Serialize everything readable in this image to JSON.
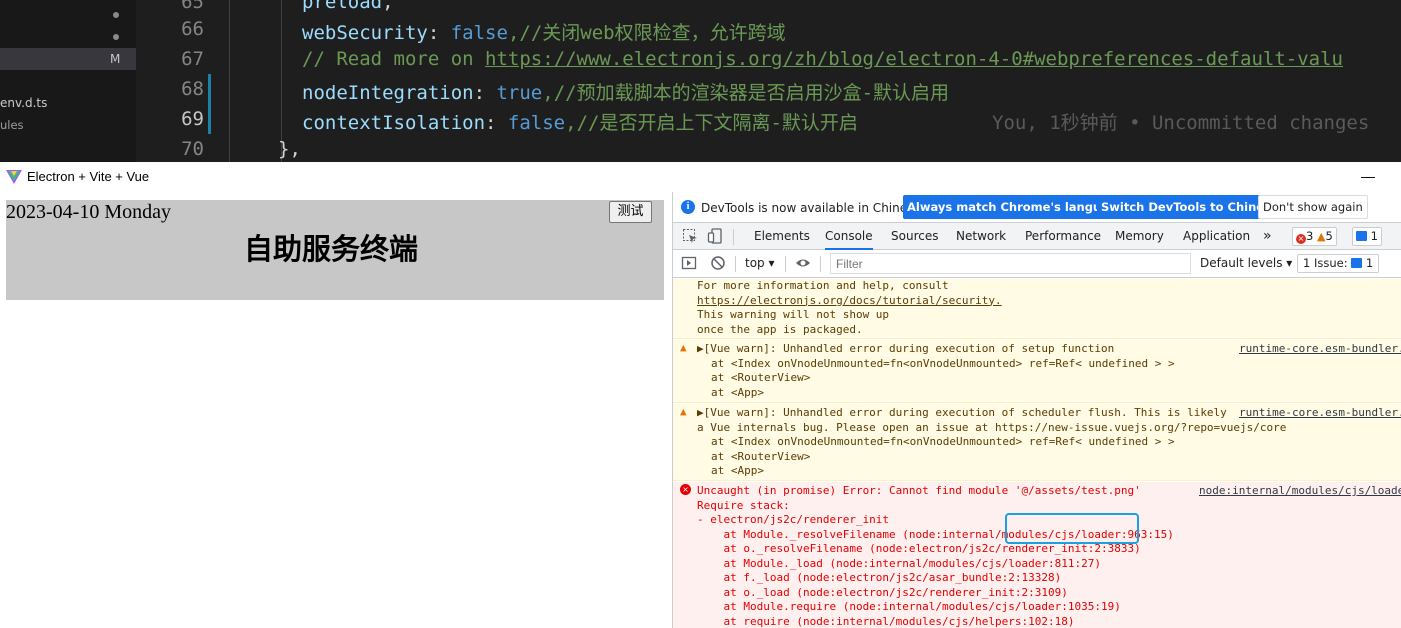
{
  "editor": {
    "explorer": {
      "rows": [
        {
          "label": "",
          "badge": "dot"
        },
        {
          "label": "",
          "badge": "dot"
        },
        {
          "label": "",
          "badge": "M"
        },
        {
          "label": "env.d.ts",
          "badge": ""
        },
        {
          "label": "ules",
          "badge": ""
        }
      ]
    },
    "lines": [
      {
        "num": "65",
        "key": "preload",
        "rest": ","
      },
      {
        "num": "66",
        "key": "webSecurity",
        "sep": ": ",
        "val": "false",
        "comment": ",//关闭web权限检查，允许跨域"
      },
      {
        "num": "67",
        "comment": "// Read more on ",
        "link": "https://www.electronjs.org/zh/blog/electron-4-0#webpreferences-default-valu"
      },
      {
        "num": "68",
        "key": "nodeIntegration",
        "sep": ": ",
        "val": "true",
        "comment": ",//预加载脚本的渲染器是否启用沙盒-默认启用"
      },
      {
        "num": "69",
        "key": "contextIsolation",
        "sep": ": ",
        "val": "false",
        "comment": ",//是否开启上下文隔离-默认开启",
        "blame": "You, 1秒钟前 • Uncommitted changes"
      },
      {
        "num": "70",
        "text": "},"
      }
    ]
  },
  "window": {
    "title": "Electron + Vite + Vue",
    "minimize": "—"
  },
  "page": {
    "date": "2023-04-10 Monday",
    "title": "自助服务终端",
    "test_button": "测试"
  },
  "devtools": {
    "info": {
      "text": "DevTools is now available in Chinese!",
      "btn_match": "Always match Chrome's language",
      "btn_switch": "Switch DevTools to Chinese",
      "btn_dont": "Don't show again"
    },
    "tabs": [
      "Elements",
      "Console",
      "Sources",
      "Network",
      "Performance",
      "Memory",
      "Application"
    ],
    "active_tab": "Console",
    "more": "»",
    "counts": {
      "errors": "3",
      "warnings": "5",
      "messages": "1"
    },
    "toolbar": {
      "context": "top",
      "filter_placeholder": "Filter",
      "levels": "Default levels",
      "issues": "1 Issue:",
      "issues_count": "1"
    },
    "console": {
      "security_tail": [
        "For more information and help, consult",
        "https://electronjs.org/docs/tutorial/security.",
        "This warning will not show up",
        "once the app is packaged."
      ],
      "warn1": {
        "head": "▶[Vue warn]: Unhandled error during execution of setup function",
        "source": "runtime-core.esm-bundler.",
        "l1": "at <Index onVnodeUnmounted=fn<onVnodeUnmounted> ref=Ref< undefined > >",
        "l2": "at <RouterView>",
        "l3": "at <App>"
      },
      "warn2": {
        "head": "▶[Vue warn]: Unhandled error during execution of scheduler flush. This is likely",
        "source": "runtime-core.esm-bundler.",
        "l0": "a Vue internals bug. Please open an issue at https://new-issue.vuejs.org/?repo=vuejs/core",
        "l1": "at <Index onVnodeUnmounted=fn<onVnodeUnmounted> ref=Ref< undefined > >",
        "l2": "at <RouterView>",
        "l3": "at <App>"
      },
      "error": {
        "head": "Uncaught (in promise) Error: Cannot find module '@/assets/test.png'",
        "source": "node:internal/modules/cjs/loade",
        "lines": [
          "Require stack:",
          "- electron/js2c/renderer_init",
          "    at Module._resolveFilename (node:internal/modules/cjs/loader:963:15)",
          "    at o._resolveFilename (node:electron/js2c/renderer_init:2:3833)",
          "    at Module._load (node:internal/modules/cjs/loader:811:27)",
          "    at f._load (node:electron/js2c/asar_bundle:2:13328)",
          "    at o._load (node:electron/js2c/renderer_init:2:3109)",
          "    at Module.require (node:internal/modules/cjs/loader:1035:19)",
          "    at require (node:internal/modules/cjs/helpers:102:18)"
        ]
      }
    }
  }
}
